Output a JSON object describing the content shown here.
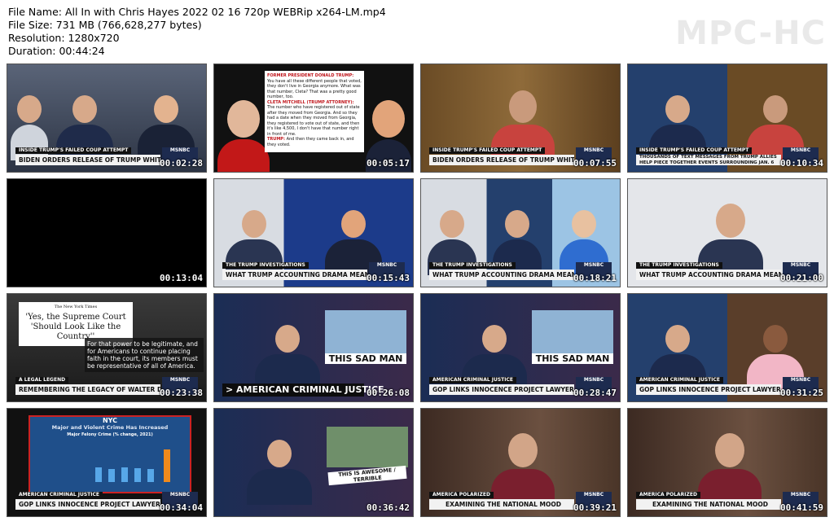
{
  "file_info": {
    "file_name": "File Name: All In with Chris Hayes 2022 02 16 720p WEBRip x264-LM.mp4",
    "file_size": "File Size: 731 MB (766,628,277 bytes)",
    "resolution": "Resolution: 1280x720",
    "duration": "Duration: 00:44:24"
  },
  "logo": "MPC-HC",
  "network": "MSNBC",
  "thumbnails": [
    {
      "tag": "INSIDE TRUMP'S FAILED COUP ATTEMPT",
      "headline": "BIDEN ORDERS RELEASE OF TRUMP WHITE HOUSE VISITOR LOGS",
      "timestamp": "00:02:28"
    },
    {
      "tag": "",
      "headline": "",
      "timestamp": "00:05:17",
      "quote": {
        "l1_label": "FORMER PRESIDENT DONALD TRUMP:",
        "l1_text": "You have all these different people that voted, they don't live in Georgia anymore. What was that number, Cleta? That was a pretty good number, too.",
        "l2_label": "CLETA MITCHELL (TRUMP ATTORNEY):",
        "l2_text": "The number who have registered out of state after they moved from Georgia. And so they had a date when they moved from Georgia, they registered to vote out of state, and then it's like 4,500, I don't have that number right in front of me.",
        "l3_label": "TRUMP:",
        "l3_text": "And then they came back in, and they voted."
      }
    },
    {
      "tag": "INSIDE TRUMP'S FAILED COUP ATTEMPT",
      "headline": "BIDEN ORDERS RELEASE OF TRUMP WHITE HOUSE VISITOR LOGS",
      "timestamp": "00:07:55"
    },
    {
      "tag": "INSIDE TRUMP'S FAILED COUP ATTEMPT",
      "headline": "THOUSANDS OF TEXT MESSAGES FROM TRUMP ALLIES HELP PIECE TOGETHER EVENTS SURROUNDING JAN. 6",
      "timestamp": "00:10:34"
    },
    {
      "tag": "",
      "headline": "",
      "timestamp": "00:13:04"
    },
    {
      "tag": "THE TRUMP INVESTIGATIONS",
      "headline": "WHAT TRUMP ACCOUNTING DRAMA MEANS FOR HIS LEGAL WOES",
      "timestamp": "00:15:43"
    },
    {
      "tag": "THE TRUMP INVESTIGATIONS",
      "headline": "WHAT TRUMP ACCOUNTING DRAMA MEANS FOR HIS LEGAL WOES",
      "timestamp": "00:18:21"
    },
    {
      "tag": "THE TRUMP INVESTIGATIONS",
      "headline": "WHAT TRUMP ACCOUNTING DRAMA MEANS FOR HIS LEGAL WOES",
      "timestamp": "00:21:00"
    },
    {
      "tag": "A LEGAL LEGEND",
      "headline": "REMEMBERING THE LEGACY OF WALTER DELLINGER",
      "timestamp": "00:23:38",
      "nyt_masthead": "The New York Times",
      "nyt_headline": "'Yes, the Supreme Court 'Should Look Like the Country''",
      "nyt_quote": "For that power to be legitimate, and for Americans to continue placing faith in the court, its members must be representative of all of America."
    },
    {
      "big_headline": "> AMERICAN CRIMINAL JUSTICE",
      "timestamp": "00:26:08",
      "sad_text": "THIS SAD MAN"
    },
    {
      "tag": "AMERICAN CRIMINAL JUSTICE",
      "headline": "GOP LINKS INNOCENCE PROJECT LAWYER TO RISE IN CRIME",
      "timestamp": "00:28:47",
      "sad_text": "THIS SAD MAN"
    },
    {
      "tag": "AMERICAN CRIMINAL JUSTICE",
      "headline": "GOP LINKS INNOCENCE PROJECT LAWYER TO RISE IN CRIME",
      "timestamp": "00:31:25"
    },
    {
      "tag": "AMERICAN CRIMINAL JUSTICE",
      "headline": "GOP LINKS INNOCENCE PROJECT LAWYER TO RISE IN CRIME",
      "timestamp": "00:34:04",
      "nyc": "NYC",
      "chart_title": "Major and Violent Crime Has Increased",
      "chart_sub": "Major Felony Crime (% change, 2021)"
    },
    {
      "tag": "",
      "headline": "",
      "timestamp": "00:36:42",
      "sign_text": "THIS IS AWESOME / TERRIBLE"
    },
    {
      "tag": "AMERICA POLARIZED",
      "headline": "EXAMINING THE NATIONAL MOOD",
      "timestamp": "00:39:21"
    },
    {
      "tag": "AMERICA POLARIZED",
      "headline": "EXAMINING THE NATIONAL MOOD",
      "timestamp": "00:41:59"
    }
  ]
}
